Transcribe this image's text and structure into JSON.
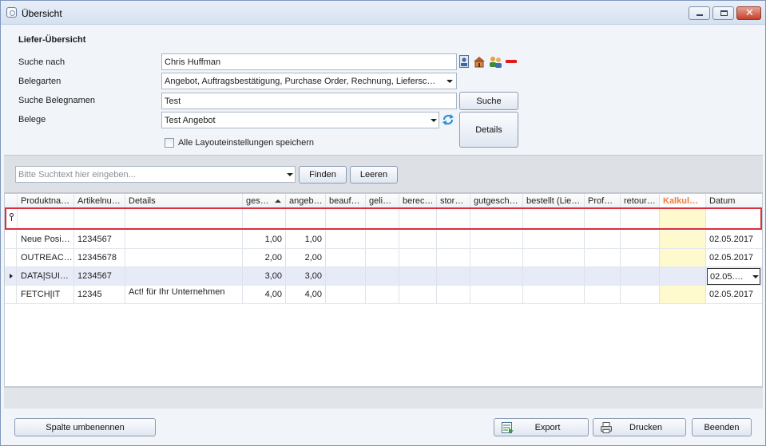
{
  "window": {
    "title": "Übersicht"
  },
  "form": {
    "section_title": "Liefer-Übersicht",
    "search_by_label": "Suche nach",
    "search_by_value": "Chris Huffman",
    "document_types_label": "Belegarten",
    "document_types_value": "Angebot, Auftragsbestätigung, Purchase Order, Rechnung, Lieferscheine",
    "doc_name_label": "Suche Belegnamen",
    "doc_name_value": "Test",
    "documents_label": "Belege",
    "documents_value": "Test Angebot",
    "save_layout_label": "Alle Layouteinstellungen speichern",
    "save_layout_checked": false,
    "search_button": "Suche",
    "details_button": "Details"
  },
  "filter": {
    "placeholder": "Bitte Suchtext hier eingeben...",
    "find_button": "Finden",
    "clear_button": "Leeren"
  },
  "grid": {
    "columns": [
      "Produktna…",
      "Artikelnu…",
      "Details",
      "ges…",
      "angeb…",
      "beauf…",
      "geli…",
      "berec…",
      "stor…",
      "gutgesch…",
      "bestellt (Lie…",
      "Prof…",
      "retour…",
      "Kalkul…",
      "Datum"
    ],
    "rows": [
      {
        "cells": [
          "Neue Posi…",
          "1234567",
          "",
          "1,00",
          "1,00",
          "",
          "",
          "",
          "",
          "",
          "",
          "",
          "",
          "",
          "02.05.2017"
        ],
        "selected": false
      },
      {
        "cells": [
          "OUTREAC…",
          "12345678",
          "",
          "2,00",
          "2,00",
          "",
          "",
          "",
          "",
          "",
          "",
          "",
          "",
          "",
          "02.05.2017"
        ],
        "selected": false
      },
      {
        "cells": [
          "DATA|SUI…",
          "1234567",
          "",
          "3,00",
          "3,00",
          "",
          "",
          "",
          "",
          "",
          "",
          "",
          "",
          "",
          "02.05.…"
        ],
        "selected": true
      },
      {
        "cells": [
          "FETCH|IT",
          "12345",
          "Act! für Ihr Unternehmen",
          "4,00",
          "4,00",
          "",
          "",
          "",
          "",
          "",
          "",
          "",
          "",
          "",
          "02.05.2017"
        ],
        "selected": false
      }
    ]
  },
  "footer": {
    "rename_column_button": "Spalte umbenennen",
    "export_button": "Export",
    "print_button": "Drucken",
    "quit_button": "Beenden"
  },
  "colors": {
    "accent_orange": "#f07c3a",
    "filter_border_red": "#d9303b",
    "calc_column_yellow": "#fffacd"
  }
}
